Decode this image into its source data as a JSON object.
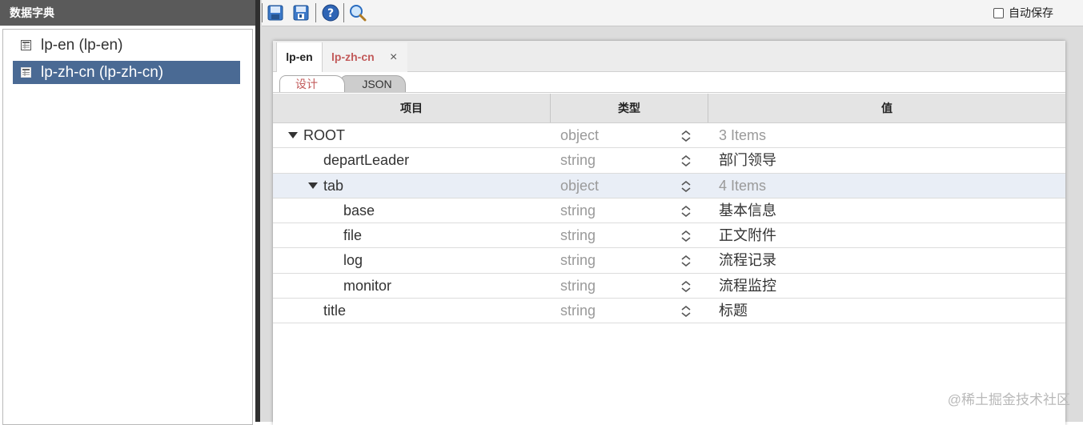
{
  "left_panel": {
    "title": "数据字典",
    "items": [
      {
        "label": "lp-en (lp-en)",
        "selected": false
      },
      {
        "label": "lp-zh-cn (lp-zh-cn)",
        "selected": true
      }
    ]
  },
  "toolbar": {
    "buttons": [
      "save-icon",
      "save-as-icon",
      "help-icon",
      "search-icon"
    ],
    "autosave_label": "自动保存",
    "autosave_checked": false
  },
  "editor": {
    "tabs": [
      {
        "label": "lp-en",
        "active": true
      },
      {
        "label": "lp-zh-cn",
        "active": false,
        "closable": true
      }
    ],
    "close_glyph": "×",
    "subtabs": [
      {
        "label": "设计",
        "active": true
      },
      {
        "label": "JSON",
        "active": false
      }
    ],
    "columns": [
      "项目",
      "类型",
      "值"
    ],
    "rows": [
      {
        "name": "ROOT",
        "type": "object",
        "value": "3 Items",
        "expanded": true,
        "muted": true
      },
      {
        "name": "departLeader",
        "type": "string",
        "value": "部门领导"
      },
      {
        "name": "tab",
        "type": "object",
        "value": "4 Items",
        "expanded": true,
        "muted": true,
        "highlight": true
      },
      {
        "name": "base",
        "type": "string",
        "value": "基本信息"
      },
      {
        "name": "file",
        "type": "string",
        "value": "正文附件"
      },
      {
        "name": "log",
        "type": "string",
        "value": "流程记录"
      },
      {
        "name": "monitor",
        "type": "string",
        "value": "流程监控"
      },
      {
        "name": "title",
        "type": "string",
        "value": "标题"
      }
    ]
  },
  "watermark": "@稀土掘金技术社区",
  "colors": {
    "selected": "#4a6a94",
    "header_bg": "#5a5a5a",
    "accent_text": "#c25a5a",
    "row_highlight": "#e9eef6"
  }
}
